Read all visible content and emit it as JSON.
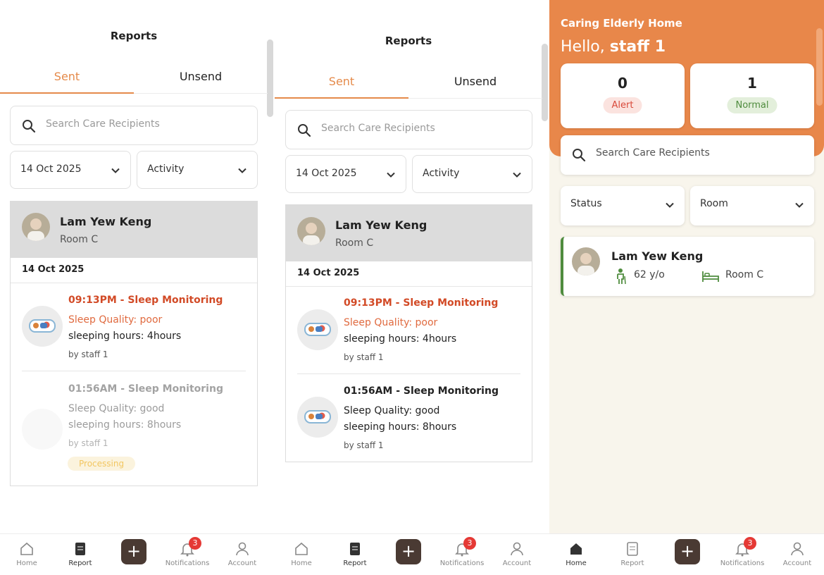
{
  "screen1": {
    "title": "Reports",
    "tabs": [
      "Sent",
      "Unsend"
    ],
    "search_placeholder": "Search Care Recipients",
    "filters": {
      "date": "14 Oct 2025",
      "activity": "Activity"
    },
    "resident": {
      "name": "Lam Yew Keng",
      "room": "Room C"
    },
    "date_header": "14 Oct 2025",
    "entries": [
      {
        "title": "09:13PM - Sleep Monitoring",
        "quality": "Sleep Quality: poor",
        "hours": "sleeping hours: 4hours",
        "by": "by staff 1"
      },
      {
        "title": "01:56AM - Sleep Monitoring",
        "quality": "Sleep Quality: good",
        "hours": "sleeping hours: 8hours",
        "by": "by staff 1",
        "status": "Processing"
      }
    ]
  },
  "screen2": {
    "title": "Reports",
    "tabs": [
      "Sent",
      "Unsend"
    ],
    "search_placeholder": "Search Care Recipients",
    "filters": {
      "date": "14 Oct 2025",
      "activity": "Activity"
    },
    "resident": {
      "name": "Lam Yew Keng",
      "room": "Room C"
    },
    "date_header": "14 Oct 2025",
    "entries": [
      {
        "title": "09:13PM - Sleep Monitoring",
        "quality": "Sleep Quality: poor",
        "hours": "sleeping hours: 4hours",
        "by": "by staff 1"
      },
      {
        "title": "01:56AM - Sleep Monitoring",
        "quality": "Sleep Quality: good",
        "hours": "sleeping hours: 8hours",
        "by": "by staff 1"
      }
    ]
  },
  "screen3": {
    "org_name": "Caring Elderly Home",
    "greeting_prefix": "Hello, ",
    "greeting_name": "staff 1",
    "stats": [
      {
        "count": "0",
        "label": "Alert"
      },
      {
        "count": "1",
        "label": "Normal"
      }
    ],
    "search_placeholder": "Search Care Recipients",
    "filters": {
      "status": "Status",
      "room": "Room"
    },
    "resident": {
      "name": "Lam Yew Keng",
      "age": "62 y/o",
      "room": "Room C"
    }
  },
  "nav": {
    "home": "Home",
    "report": "Report",
    "notifications": "Notifications",
    "account": "Account",
    "notif_count": "3"
  },
  "colors": {
    "accent": "#e8874a",
    "alert": "#d9493a",
    "normal": "#4f8c3e",
    "dark_button": "#4a3a33"
  }
}
